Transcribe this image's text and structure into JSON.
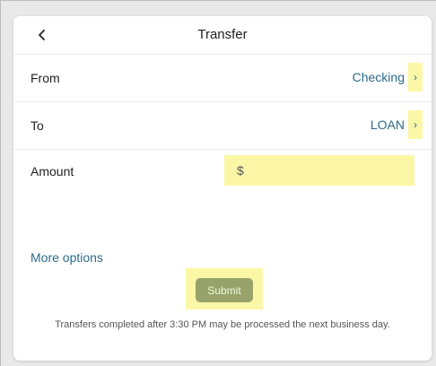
{
  "header": {
    "title": "Transfer",
    "back_icon": "chevron-left-icon"
  },
  "from": {
    "label": "From",
    "value": "Checking",
    "chevron": "›"
  },
  "to": {
    "label": "To",
    "value": "LOAN",
    "chevron": "›"
  },
  "amount": {
    "label": "Amount",
    "currency_symbol": "$",
    "value": "",
    "placeholder": ""
  },
  "more_options_label": "More options",
  "submit_label": "Submit",
  "disclaimer": "Transfers completed after 3:30 PM may be processed the next business day.",
  "colors": {
    "link": "#2e6b8a",
    "highlight": "#fbf7a6",
    "submit_bg": "#98a36c"
  }
}
